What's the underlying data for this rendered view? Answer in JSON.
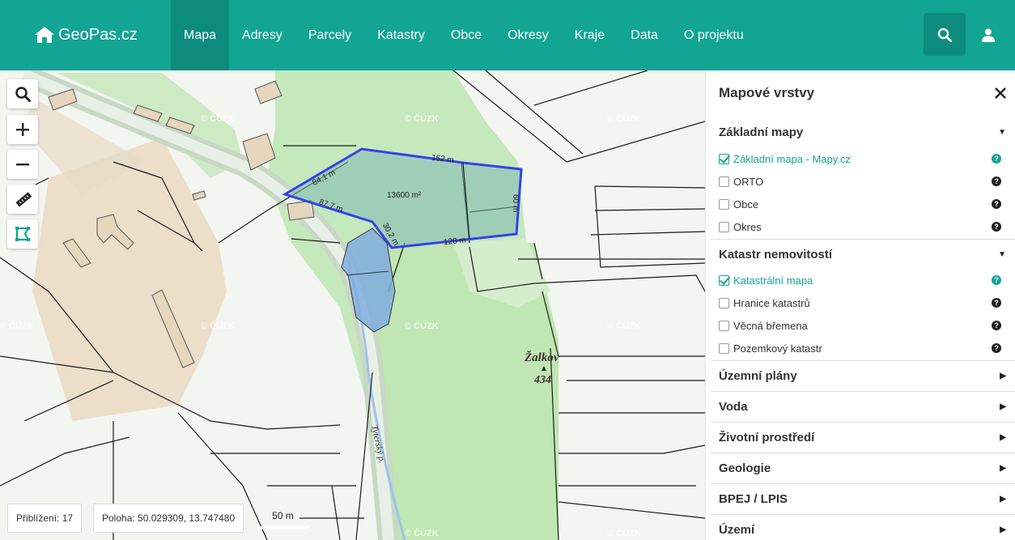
{
  "header": {
    "brand": "GeoPas.cz",
    "nav": [
      "Mapa",
      "Adresy",
      "Parcely",
      "Katastry",
      "Obce",
      "Okresy",
      "Kraje",
      "Data",
      "O projektu"
    ],
    "active_nav": "Mapa",
    "search_icon": "search-icon",
    "user_icon": "user-icon",
    "accent_color": "#12a594"
  },
  "map": {
    "tools": [
      "search-icon",
      "zoom-in-icon",
      "zoom-out-icon",
      "ruler-icon",
      "polygon-icon"
    ],
    "watermark": "© ČÚZK",
    "measurements": {
      "area": "13600 m²",
      "segments": [
        "84,1 m",
        "152 m",
        "60 m",
        "120 m",
        "30,2 m",
        "87,7 m"
      ]
    },
    "place_name": "Žalkov",
    "elevation": "434",
    "stream_name": "Tyterský p.",
    "status": {
      "zoom": "Přiblížení: 17",
      "position": "Poloha: 50.029309, 13.747480",
      "scale": "50 m"
    }
  },
  "panel": {
    "title": "Mapové vrstvy",
    "close_icon": "close-icon",
    "sections": [
      {
        "name": "Základní mapy",
        "expanded": true,
        "layers": [
          {
            "label": "Základní mapa - Mapy.cz",
            "checked": true
          },
          {
            "label": "ORTO",
            "checked": false
          },
          {
            "label": "Obce",
            "checked": false
          },
          {
            "label": "Okres",
            "checked": false
          }
        ]
      },
      {
        "name": "Katastr nemovitostí",
        "expanded": true,
        "layers": [
          {
            "label": "Katastrální mapa",
            "checked": true
          },
          {
            "label": "Hranice katastrů",
            "checked": false
          },
          {
            "label": "Věcná břemena",
            "checked": false
          },
          {
            "label": "Pozemkový katastr",
            "checked": false
          }
        ]
      },
      {
        "name": "Územní plány",
        "expanded": false
      },
      {
        "name": "Voda",
        "expanded": false
      },
      {
        "name": "Životní prostředí",
        "expanded": false
      },
      {
        "name": "Geologie",
        "expanded": false
      },
      {
        "name": "BPEJ / LPIS",
        "expanded": false
      },
      {
        "name": "Území",
        "expanded": false
      }
    ]
  }
}
